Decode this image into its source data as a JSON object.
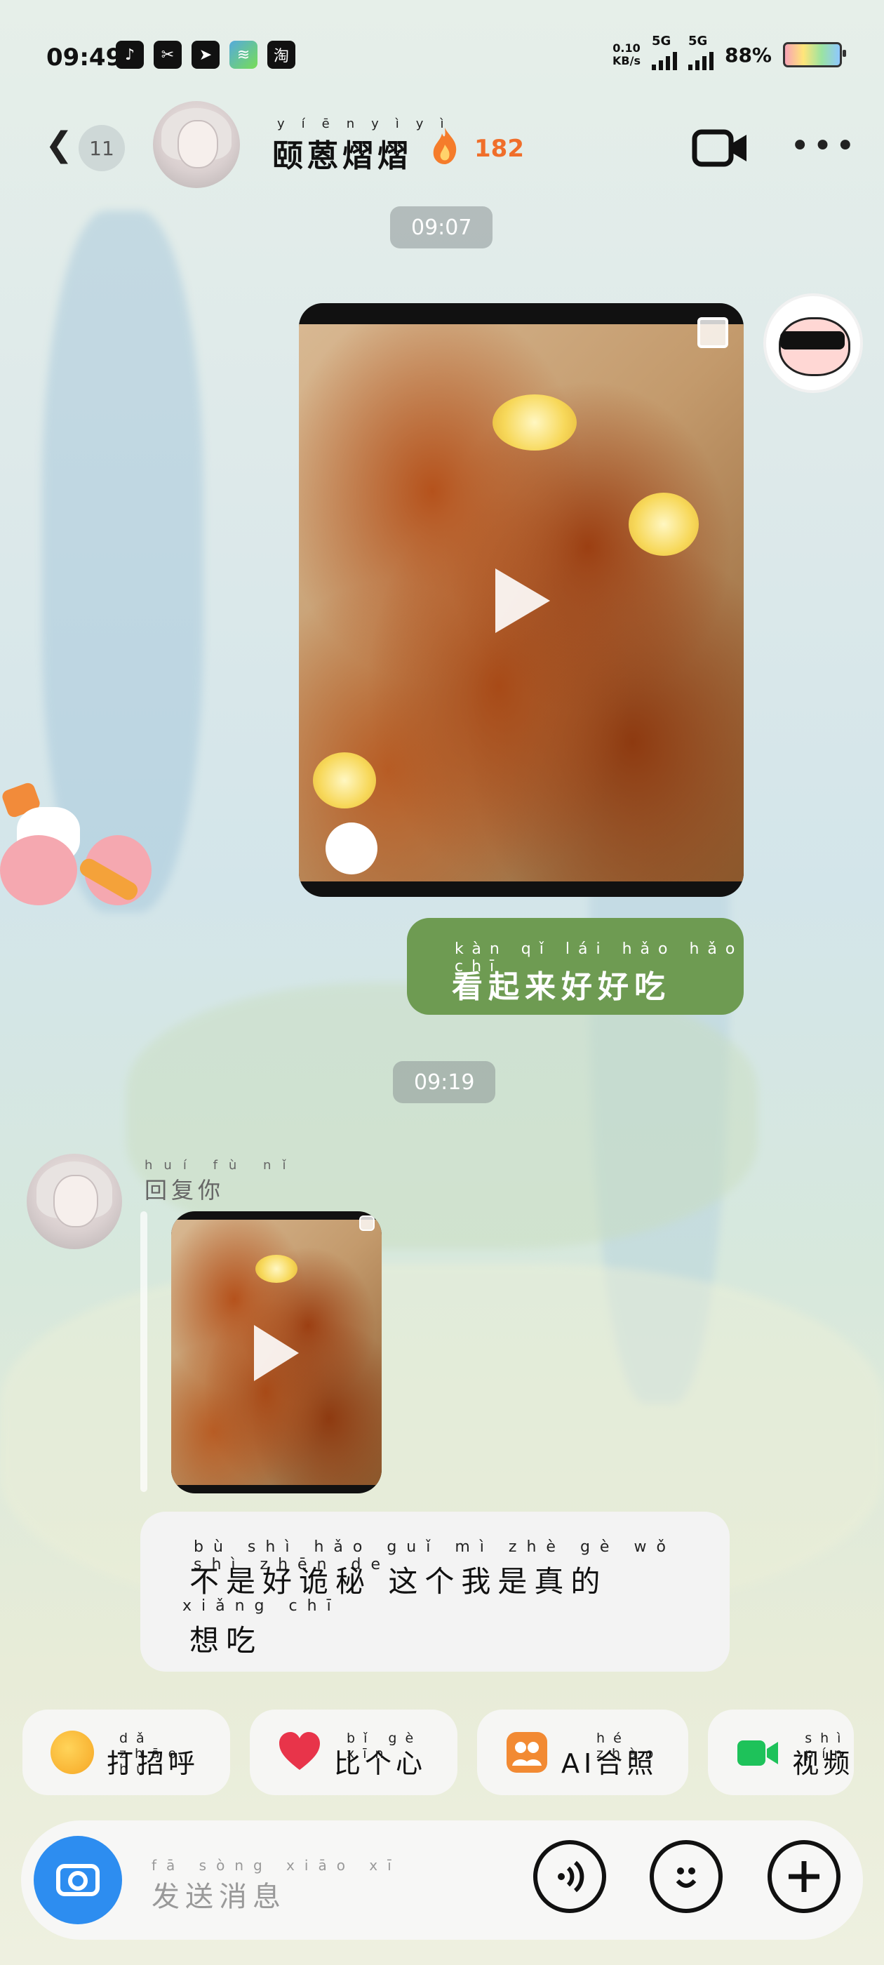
{
  "status_bar": {
    "time": "09:49",
    "app_icons": [
      "♪",
      "✂",
      "➤",
      "≋",
      "淘"
    ],
    "net_speed_value": "0.10",
    "net_speed_unit": "KB/s",
    "signal1_label": "5G",
    "signal2_label": "5G",
    "battery": "88%"
  },
  "header": {
    "unread_count": "11",
    "contact_name": "颐蒽熠熠",
    "contact_name_pinyin": [
      "yí",
      "ēn",
      "yì",
      "yì"
    ],
    "streak_count": "182"
  },
  "messages": [
    {
      "type": "time",
      "text": "09:07"
    },
    {
      "type": "video",
      "sender": "me"
    },
    {
      "type": "text",
      "sender": "me",
      "pinyin": [
        "kàn",
        "qǐ",
        "lái",
        "hǎo",
        "hǎo",
        "chī"
      ],
      "text": "看起来好好吃"
    },
    {
      "type": "time",
      "text": "09:19"
    },
    {
      "type": "reply_label",
      "sender": "contact",
      "pinyin": [
        "huí",
        "fù",
        "nǐ"
      ],
      "text": "回复你"
    },
    {
      "type": "video",
      "sender": "contact"
    },
    {
      "type": "text",
      "sender": "contact",
      "lines": [
        {
          "pinyin": [
            "bù",
            "shì",
            "hǎo",
            "guǐ",
            "mì",
            "zhè",
            "gè",
            "wǒ",
            "shì",
            "zhēn",
            "de"
          ],
          "text": "不是好诡秘 这个我是真的"
        },
        {
          "pinyin": [
            "xiǎng",
            "chī"
          ],
          "text": "想吃"
        }
      ]
    }
  ],
  "quick_actions": [
    {
      "label": "打招呼",
      "pinyin": [
        "dǎ",
        "zhāo",
        "hū"
      ],
      "icon": "wave-emoji-icon"
    },
    {
      "label": "比个心",
      "pinyin": [
        "bǐ",
        "gè",
        "xīn"
      ],
      "icon": "heart-icon"
    },
    {
      "label": "AI合照",
      "pinyin": [
        "hé",
        "zhào"
      ],
      "icon": "ai-photo-icon"
    },
    {
      "label": "视频",
      "pinyin": [
        "shì",
        "pín"
      ],
      "icon": "video-call-icon"
    }
  ],
  "input": {
    "placeholder": "发送消息",
    "placeholder_pinyin": [
      "fā",
      "sòng",
      "xiāo",
      "xī"
    ]
  },
  "colors": {
    "accent_blue": "#2d8df0",
    "bubble_green": "#6e9b52",
    "streak_orange": "#f06e2a"
  }
}
